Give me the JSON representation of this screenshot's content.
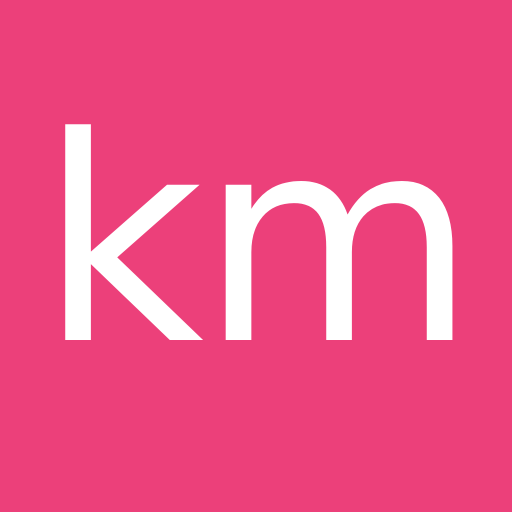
{
  "avatar": {
    "initials": "km",
    "background_color": "#ec407a",
    "text_color": "#ffffff"
  }
}
